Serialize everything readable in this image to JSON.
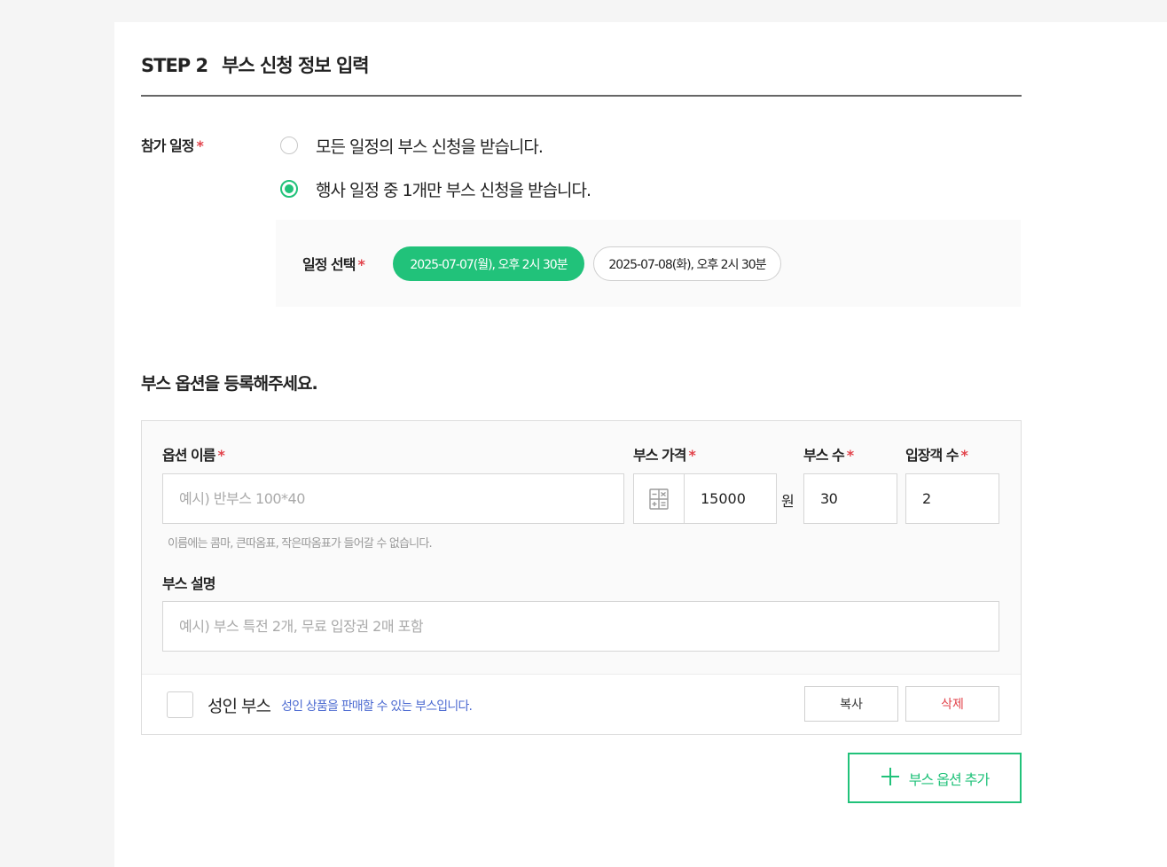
{
  "step": {
    "number": "STEP 2",
    "title": "부스 신청 정보 입력"
  },
  "schedule": {
    "label": "참가 일정",
    "required_mark": "*",
    "options": [
      {
        "label": "모든 일정의 부스 신청을 받습니다.",
        "checked": false
      },
      {
        "label": "행사 일정 중 1개만 부스 신청을 받습니다.",
        "checked": true
      }
    ],
    "date_select": {
      "label": "일정 선택",
      "required_mark": "*",
      "dates": [
        {
          "label": "2025-07-07(월), 오후 2시 30분",
          "selected": true
        },
        {
          "label": "2025-07-08(화), 오후 2시 30분",
          "selected": false
        }
      ]
    }
  },
  "options_section": {
    "heading": "부스 옵션을 등록해주세요.",
    "option": {
      "name_label": "옵션 이름",
      "name_placeholder": "예시) 반부스 100*40",
      "name_value": "",
      "name_hint": "이름에는 콤마, 큰따옴표, 작은따옴표가 들어갈 수 없습니다.",
      "price_label": "부스 가격",
      "price_value": "15000",
      "price_unit": "원",
      "count_label": "부스 수",
      "count_value": "30",
      "visitors_label": "입장객 수",
      "visitors_value": "2",
      "desc_label": "부스 설명",
      "desc_placeholder": "예시) 부스 특전 2개, 무료 입장권 2매 포함",
      "desc_value": "",
      "required_mark": "*",
      "adult_label": "성인 부스",
      "adult_desc": "성인 상품을 판매할 수 있는 부스입니다.",
      "adult_checked": false,
      "copy_label": "복사",
      "delete_label": "삭제"
    },
    "add_button_label": "부스 옵션 추가"
  },
  "colors": {
    "accent": "#21c27a",
    "required": "#e2434b",
    "info": "#4d6bd1"
  }
}
